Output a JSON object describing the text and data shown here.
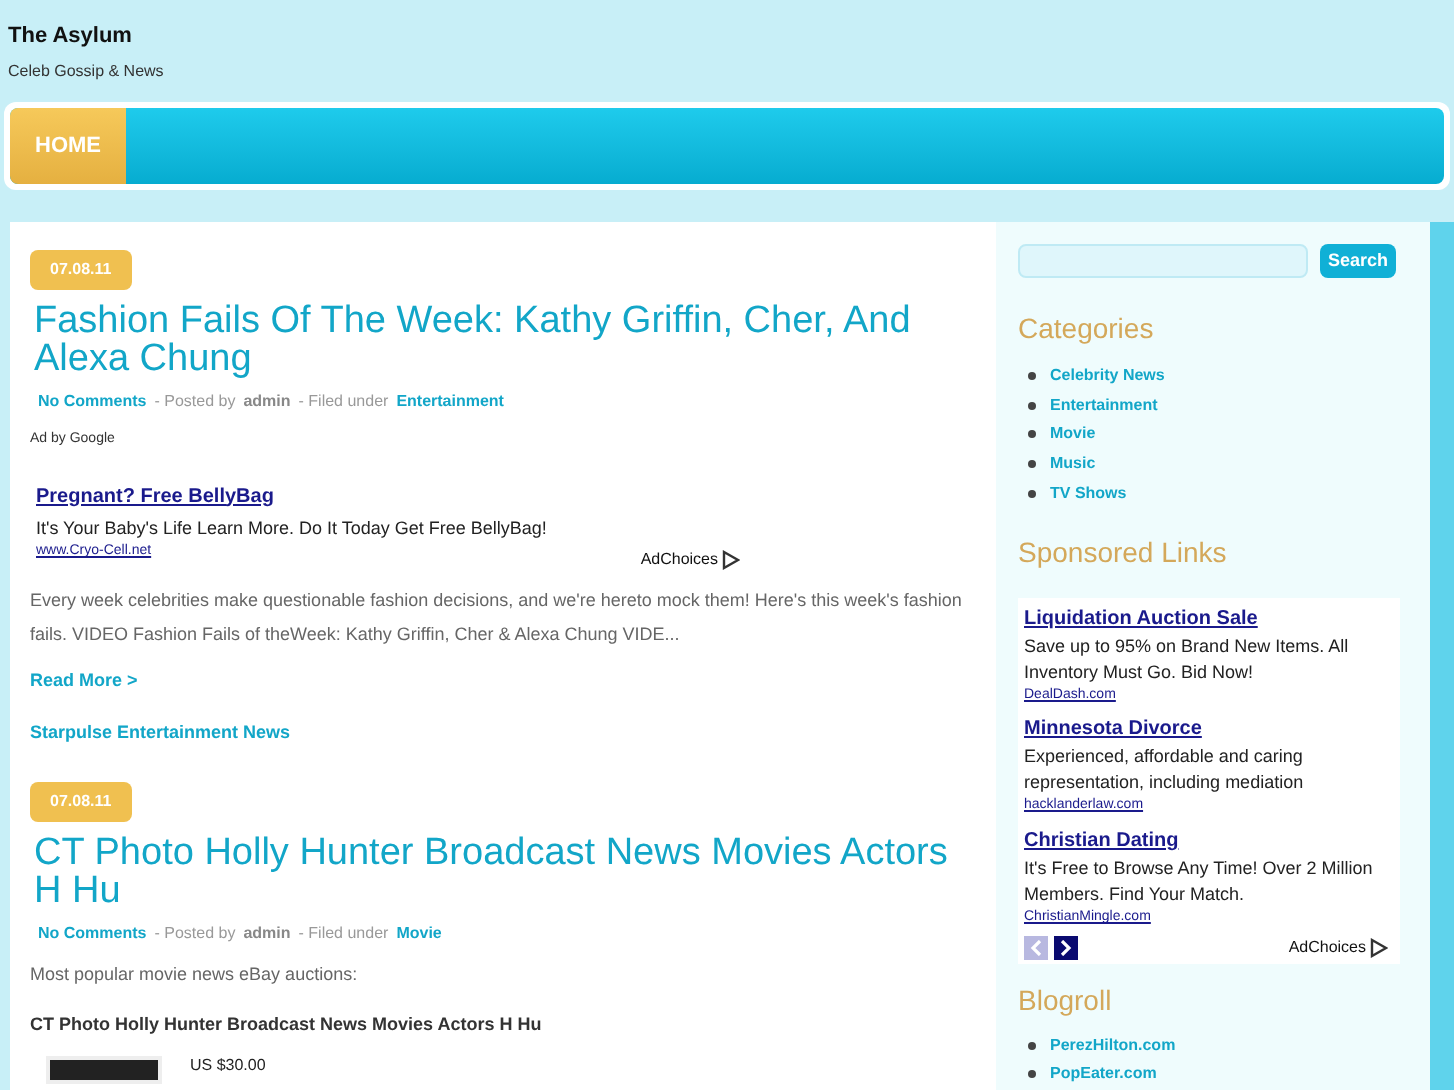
{
  "site": {
    "title": "The Asylum",
    "tagline": "Celeb Gossip & News"
  },
  "nav": [
    {
      "label": "HOME",
      "selected": true
    }
  ],
  "posts": [
    {
      "date": "07.08.11",
      "title": "Fashion Fails Of The Week: Kathy Griffin, Cher, And Alexa Chung",
      "comments": "No Comments",
      "posted_by": "- Posted by",
      "author": "admin",
      "filed_under": "- Filed under",
      "category": "Entertainment",
      "ad": {
        "label": "Ad by Google",
        "title": "Pregnant? Free BellyBag",
        "text": "It's Your Baby's Life Learn More. Do It Today Get Free BellyBag!",
        "url": "www.Cryo-Cell.net",
        "adchoices": "AdChoices"
      },
      "excerpt": "Every week celebrities make questionable fashion decisions, and we're hereto mock them! Here's this week's fashion fails. VIDEO Fashion Fails of theWeek: Kathy Griffin, Cher & Alexa Chung VIDE...",
      "read_more": "Read More >",
      "source": "Starpulse Entertainment News"
    },
    {
      "date": "07.08.11",
      "title": "CT Photo Holly Hunter Broadcast News Movies Actors H Hu",
      "comments": "No Comments",
      "posted_by": "- Posted by",
      "author": "admin",
      "filed_under": "- Filed under",
      "category": "Movie",
      "excerpt": "Most popular movie news eBay auctions:",
      "subheading": "CT Photo Holly Hunter Broadcast News Movies Actors H Hu",
      "price": "US $30.00"
    }
  ],
  "sidebar": {
    "search_button": "Search",
    "categories": {
      "heading": "Categories",
      "items": [
        "Celebrity News",
        "Entertainment",
        "Movie",
        "Music",
        "TV Shows"
      ]
    },
    "sponsored": {
      "heading": "Sponsored Links",
      "ads": [
        {
          "title": "Liquidation Auction Sale",
          "text": "Save up to 95% on Brand New Items. All Inventory Must Go. Bid Now!",
          "url": "DealDash.com"
        },
        {
          "title": "Minnesota Divorce",
          "text": "Experienced, affordable and caring representation, including mediation",
          "url": "hacklanderlaw.com"
        },
        {
          "title": "Christian Dating",
          "text": "It's Free to Browse Any Time! Over 2 Million Members. Find Your Match.",
          "url": "ChristianMingle.com"
        }
      ],
      "pager": [
        {
          "kind": "prev",
          "disabled": true
        },
        {
          "kind": "next",
          "disabled": false
        }
      ],
      "adchoices": "AdChoices"
    },
    "blogroll": {
      "heading": "Blogroll",
      "items": [
        "PerezHilton.com",
        "PopEater.com"
      ]
    }
  }
}
